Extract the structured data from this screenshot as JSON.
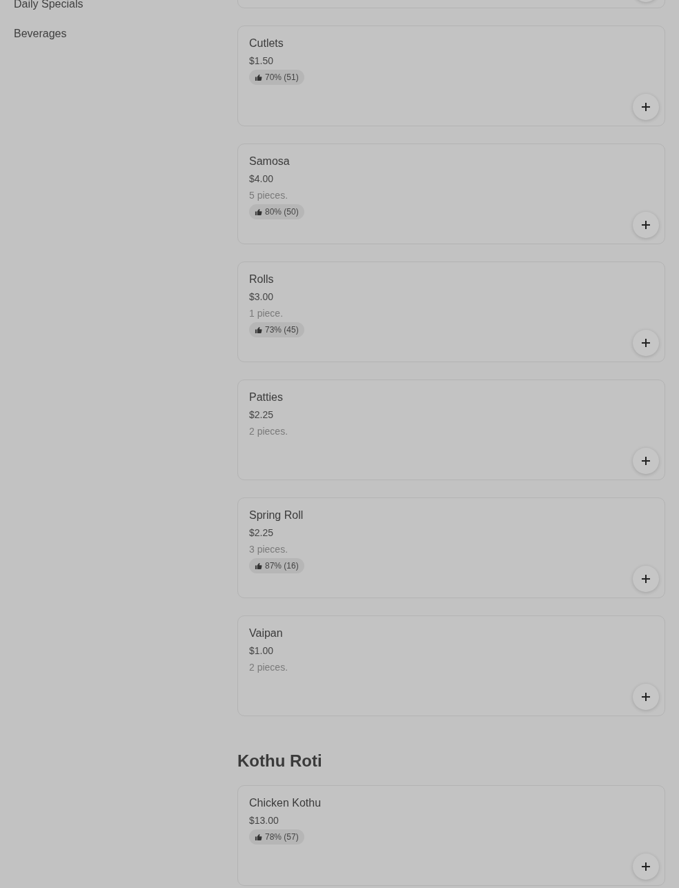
{
  "sidebar": {
    "items": [
      {
        "label": "Daily Specials"
      },
      {
        "label": "Beverages"
      }
    ]
  },
  "sections": [
    {
      "items": [
        {
          "kind": "cut"
        },
        {
          "kind": "item",
          "name": "Cutlets",
          "price": "$1.50",
          "rating": "70% (51)"
        },
        {
          "kind": "item",
          "name": "Samosa",
          "price": "$4.00",
          "description": "5 pieces.",
          "rating": "80% (50)"
        },
        {
          "kind": "item",
          "name": "Rolls",
          "price": "$3.00",
          "description": "1 piece.",
          "rating": "73% (45)"
        },
        {
          "kind": "item",
          "name": "Patties",
          "price": "$2.25",
          "description": "2 pieces."
        },
        {
          "kind": "item",
          "name": "Spring Roll",
          "price": "$2.25",
          "description": "3 pieces.",
          "rating": "87% (16)"
        },
        {
          "kind": "item",
          "name": "Vaipan",
          "price": "$1.00",
          "description": "2 pieces."
        }
      ]
    },
    {
      "heading": "Kothu Roti",
      "items": [
        {
          "kind": "item",
          "name": "Chicken Kothu",
          "price": "$13.00",
          "rating": "78% (57)"
        }
      ]
    }
  ]
}
